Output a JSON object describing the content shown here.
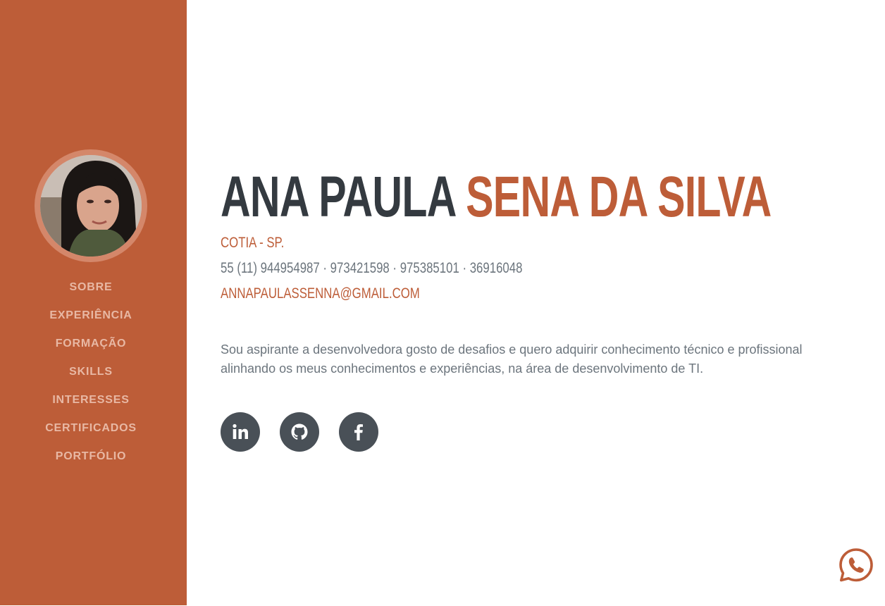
{
  "nav": {
    "items": [
      {
        "label": "SOBRE"
      },
      {
        "label": "EXPERIÊNCIA"
      },
      {
        "label": "FORMAÇÃO"
      },
      {
        "label": "SKILLS"
      },
      {
        "label": "INTERESSES"
      },
      {
        "label": "CERTIFICADOS"
      },
      {
        "label": "PORTFÓLIO"
      }
    ]
  },
  "profile": {
    "first_name": "ANA PAULA",
    "last_name": "SENA DA SILVA",
    "city": "COTIA - SP.",
    "phones": "55 (11) 944954987 · 973421598 · 975385101 · 36916048",
    "email": "ANNAPAULASSENNA@GMAIL.COM",
    "bio": "Sou aspirante a desenvolvedora gosto de desafios e quero adquirir conhecimento técnico e profissional alinhando os meus conhecimentos e experiências, na área de desenvolvimento de TI."
  },
  "social": [
    {
      "icon": "linkedin-icon"
    },
    {
      "icon": "github-icon"
    },
    {
      "icon": "facebook-icon"
    }
  ],
  "floating": {
    "icon": "whatsapp-icon"
  },
  "colors": {
    "accent": "#bd5d38",
    "dark": "#343a40",
    "muted": "#6c757d",
    "social_bg": "#495057",
    "nav_text": "#e8b8a4"
  }
}
